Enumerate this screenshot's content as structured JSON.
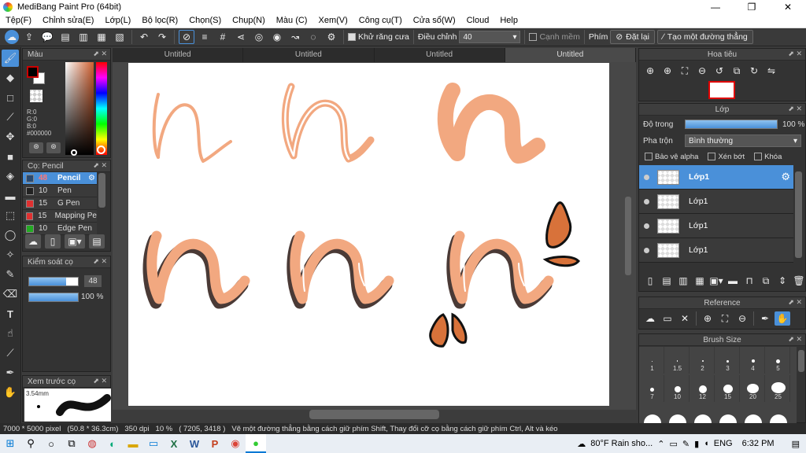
{
  "window": {
    "title": "MediBang Paint Pro (64bit)",
    "minimize": "—",
    "restore": "❐",
    "close": "✕"
  },
  "menu": [
    "Tệp(F)",
    "Chỉnh sửa(E)",
    "Lớp(L)",
    "Bộ lọc(R)",
    "Chọn(S)",
    "Chụp(N)",
    "Màu (C)",
    "Xem(V)",
    "Công cụ(T)",
    "Cửa sổ(W)",
    "Cloud",
    "Help"
  ],
  "toolbar": {
    "antialias_label": "Khử răng cưa",
    "correction_label": "Điều chỉnh",
    "correction_value": "40",
    "soft_edge_label": "Cạnh mềm",
    "key_label": "Phím",
    "reset_label": "Đặt lại",
    "line_label": "Tạo một đường thẳng"
  },
  "color_panel": {
    "title": "Màu",
    "r": "R:0",
    "g": "G:0",
    "b": "B:0",
    "hex": "#000000",
    "primary": "#000000",
    "accent": "#cc0000"
  },
  "brush_panel": {
    "title": "Cọ: Pencil",
    "items": [
      {
        "size": "48",
        "name": "Pencil",
        "color": "#2a4a70"
      },
      {
        "size": "10",
        "name": "Pen",
        "color": "#222222"
      },
      {
        "size": "15",
        "name": "G Pen",
        "color": "#e03030"
      },
      {
        "size": "15",
        "name": "Mapping Pe",
        "color": "#e03030"
      },
      {
        "size": "10",
        "name": "Edge Pen",
        "color": "#22aa22"
      }
    ]
  },
  "brush_control": {
    "title": "Kiểm soát cọ",
    "size_value": "48",
    "size_fill": 0.75,
    "opacity_value": "100 %",
    "opacity_fill": 1.0
  },
  "preview_panel": {
    "title": "Xem trước cọ",
    "size_text": "3.54mm"
  },
  "tabs": [
    "Untitled",
    "Untitled",
    "Untitled",
    "Untitled"
  ],
  "navigator": {
    "title": "Hoa tiêu"
  },
  "layer_panel": {
    "title": "Lớp",
    "opacity_label": "Độ trong",
    "opacity_value": "100 %",
    "opacity_fill": 1.0,
    "blend_label": "Pha trộn",
    "blend_value": "Bình thường",
    "protect_alpha": "Bảo vệ alpha",
    "clipping": "Xén bớt",
    "lock": "Khóa",
    "layers": [
      "Lớp1",
      "Lớp1",
      "Lớp1",
      "Lớp1"
    ]
  },
  "reference_panel": {
    "title": "Reference"
  },
  "brush_size_panel": {
    "title": "Brush Size",
    "sizes_row1": [
      "1",
      "1.5",
      "2",
      "3",
      "4",
      "5"
    ],
    "sizes_row2": [
      "7",
      "10",
      "12",
      "15",
      "20",
      "25"
    ]
  },
  "status": {
    "size": "7000 * 5000 pixel",
    "physical": "(50.8 * 36.3cm)",
    "dpi": "350 dpi",
    "zoom": "10 %",
    "coords": "( 7205, 3418 )",
    "hint": "Vẽ một đường thẳng bằng cách giữ phím Shift, Thay đổi cỡ cọ bằng cách giữ phím Ctrl, Alt và kéo"
  },
  "taskbar": {
    "weather": "80°F  Rain sho...",
    "lang": "ENG",
    "time": "6:32 PM"
  },
  "colors": {
    "stroke_fill": "#f2a880",
    "stroke_shadow": "#4a3a36",
    "stroke_dark": "#d8723a",
    "accent": "#4a90d9"
  }
}
